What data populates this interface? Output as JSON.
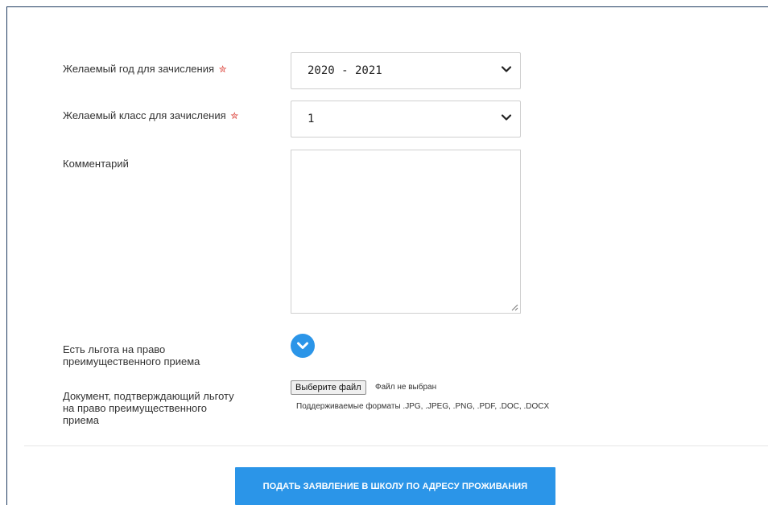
{
  "form": {
    "year_label": "Желаемый год для зачисления",
    "year_value": "2020 - 2021",
    "class_label": "Желаемый класс для зачисления",
    "class_value": "1",
    "required_mark": "✮",
    "comment_label": "Комментарий",
    "comment_value": "",
    "benefit_label": "Есть льгота на право преимущественного приема",
    "document_label": "Документ, подтверждающий льготу на право преимущественного приема",
    "file_button_label": "Выберите файл",
    "file_status": "Файл не выбран",
    "formats_hint": "Поддерживаемые форматы .JPG, .JPEG, .PNG, .PDF, .DOC, .DOCX"
  },
  "submit_label": "ПОДАТЬ ЗАЯВЛЕНИЕ В ШКОЛУ ПО АДРЕСУ ПРОЖИВАНИЯ",
  "icons": {
    "select_arrow": "chevron-down-icon",
    "benefit_toggle": "chevron-down-icon",
    "required": "star-icon"
  },
  "colors": {
    "accent": "#2b95e8",
    "required": "#d9342b",
    "frame_border": "#1f3b5f"
  }
}
